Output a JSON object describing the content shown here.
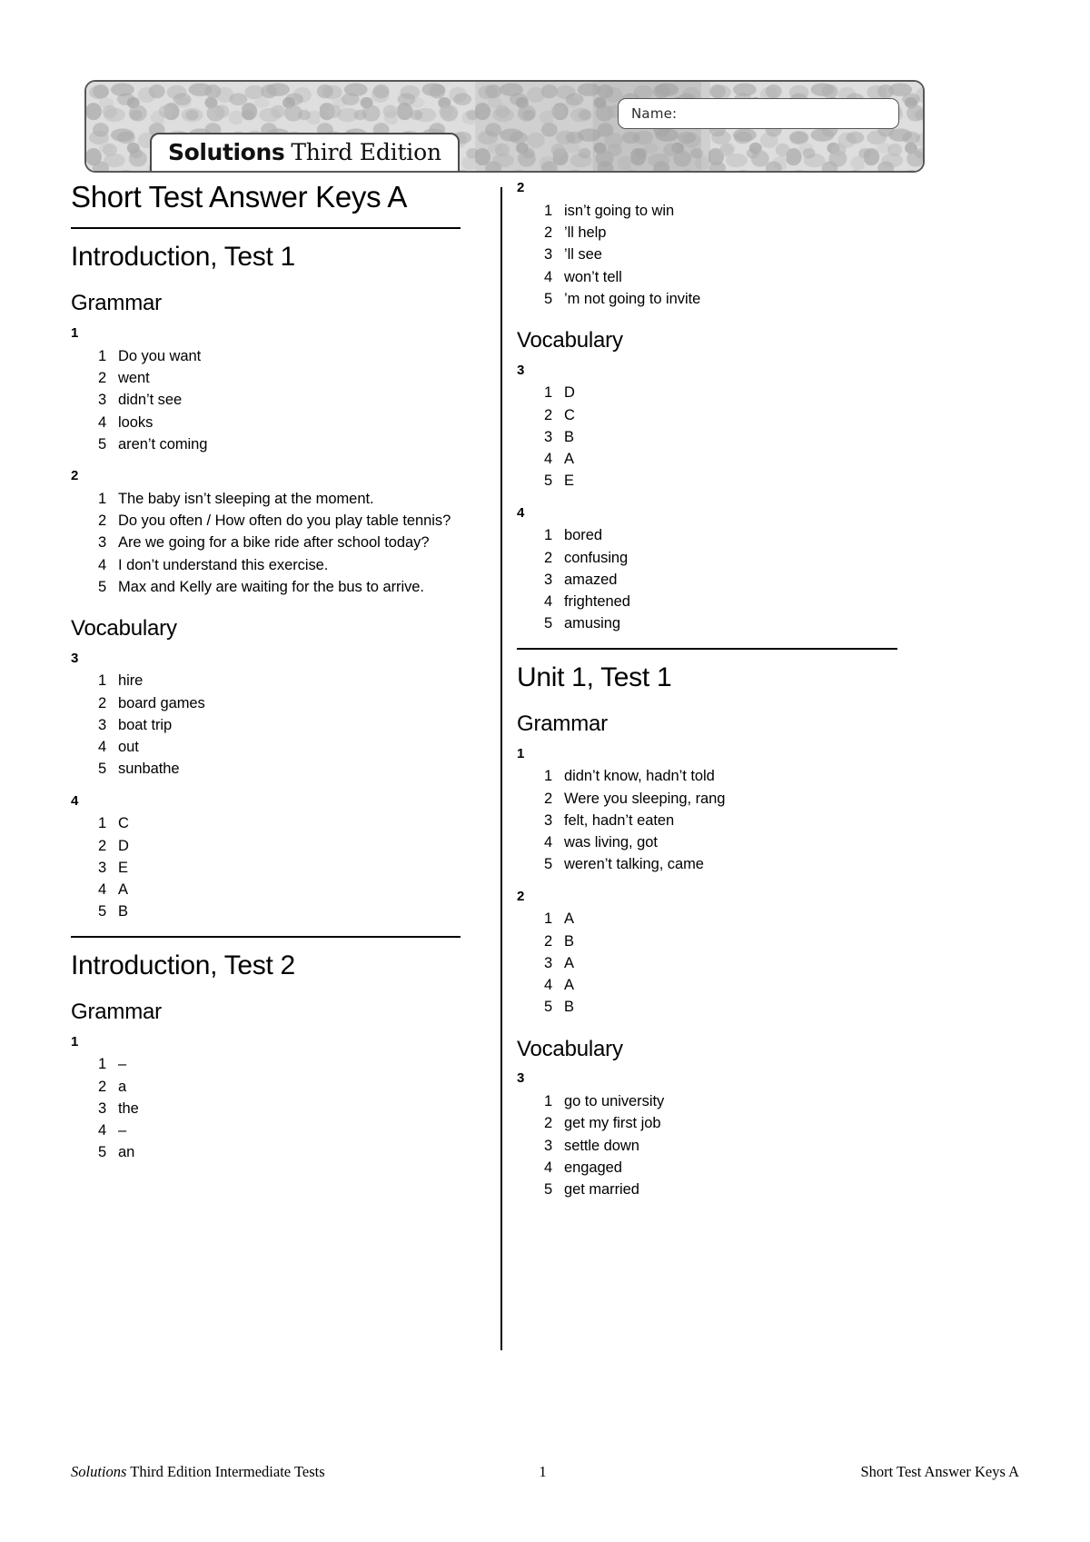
{
  "header": {
    "name_label": "Name:",
    "logo_bold": "Solutions",
    "logo_rest": "Third Edition"
  },
  "document": {
    "title": "Short Test Answer Keys A"
  },
  "sections": {
    "intro_test_1": {
      "title": "Introduction, Test 1",
      "grammar_heading": "Grammar",
      "vocabulary_heading": "Vocabulary",
      "ex1": {
        "num": "1",
        "items": [
          {
            "idx": "1",
            "txt": "Do you want"
          },
          {
            "idx": "2",
            "txt": "went"
          },
          {
            "idx": "3",
            "txt": "didn’t see"
          },
          {
            "idx": "4",
            "txt": "looks"
          },
          {
            "idx": "5",
            "txt": "aren’t coming"
          }
        ]
      },
      "ex2": {
        "num": "2",
        "items": [
          {
            "idx": "1",
            "txt": "The baby isn’t sleeping at the moment."
          },
          {
            "idx": "2",
            "txt": "Do you often / How often do you play table tennis?"
          },
          {
            "idx": "3",
            "txt": "Are we going for a bike ride after school today?"
          },
          {
            "idx": "4",
            "txt": "I don’t understand this exercise."
          },
          {
            "idx": "5",
            "txt": "Max and Kelly are waiting for the bus to arrive."
          }
        ]
      },
      "ex3": {
        "num": "3",
        "items": [
          {
            "idx": "1",
            "txt": "hire"
          },
          {
            "idx": "2",
            "txt": "board games"
          },
          {
            "idx": "3",
            "txt": "boat trip"
          },
          {
            "idx": "4",
            "txt": "out"
          },
          {
            "idx": "5",
            "txt": "sunbathe"
          }
        ]
      },
      "ex4": {
        "num": "4",
        "items": [
          {
            "idx": "1",
            "txt": "C"
          },
          {
            "idx": "2",
            "txt": "D"
          },
          {
            "idx": "3",
            "txt": "E"
          },
          {
            "idx": "4",
            "txt": "A"
          },
          {
            "idx": "5",
            "txt": "B"
          }
        ]
      }
    },
    "intro_test_2": {
      "title": "Introduction, Test 2",
      "grammar_heading": "Grammar",
      "vocabulary_heading": "Vocabulary",
      "ex1": {
        "num": "1",
        "items": [
          {
            "idx": "1",
            "txt": "–"
          },
          {
            "idx": "2",
            "txt": "a"
          },
          {
            "idx": "3",
            "txt": "the"
          },
          {
            "idx": "4",
            "txt": "–"
          },
          {
            "idx": "5",
            "txt": "an"
          }
        ]
      },
      "ex2": {
        "num": "2",
        "items": [
          {
            "idx": "1",
            "txt": "isn’t going to win"
          },
          {
            "idx": "2",
            "txt": "’ll help"
          },
          {
            "idx": "3",
            "txt": "’ll see"
          },
          {
            "idx": "4",
            "txt": "won’t tell"
          },
          {
            "idx": "5",
            "txt": "’m not going to invite"
          }
        ]
      },
      "ex3": {
        "num": "3",
        "items": [
          {
            "idx": "1",
            "txt": "D"
          },
          {
            "idx": "2",
            "txt": "C"
          },
          {
            "idx": "3",
            "txt": "B"
          },
          {
            "idx": "4",
            "txt": "A"
          },
          {
            "idx": "5",
            "txt": "E"
          }
        ]
      },
      "ex4": {
        "num": "4",
        "items": [
          {
            "idx": "1",
            "txt": "bored"
          },
          {
            "idx": "2",
            "txt": "confusing"
          },
          {
            "idx": "3",
            "txt": "amazed"
          },
          {
            "idx": "4",
            "txt": "frightened"
          },
          {
            "idx": "5",
            "txt": "amusing"
          }
        ]
      }
    },
    "unit_1_test_1": {
      "title": "Unit 1, Test 1",
      "grammar_heading": "Grammar",
      "vocabulary_heading": "Vocabulary",
      "ex1": {
        "num": "1",
        "items": [
          {
            "idx": "1",
            "txt": "didn’t know, hadn’t told"
          },
          {
            "idx": "2",
            "txt": "Were you sleeping, rang"
          },
          {
            "idx": "3",
            "txt": "felt, hadn’t eaten"
          },
          {
            "idx": "4",
            "txt": "was living, got"
          },
          {
            "idx": "5",
            "txt": "weren’t talking, came"
          }
        ]
      },
      "ex2": {
        "num": "2",
        "items": [
          {
            "idx": "1",
            "txt": "A"
          },
          {
            "idx": "2",
            "txt": "B"
          },
          {
            "idx": "3",
            "txt": "A"
          },
          {
            "idx": "4",
            "txt": "A"
          },
          {
            "idx": "5",
            "txt": "B"
          }
        ]
      },
      "ex3": {
        "num": "3",
        "items": [
          {
            "idx": "1",
            "txt": "go to university"
          },
          {
            "idx": "2",
            "txt": "get my first job"
          },
          {
            "idx": "3",
            "txt": "settle down"
          },
          {
            "idx": "4",
            "txt": "engaged"
          },
          {
            "idx": "5",
            "txt": "get married"
          }
        ]
      }
    }
  },
  "footer": {
    "left_italic": "Solutions",
    "left_rest": " Third Edition Intermediate Tests",
    "page_number": "1",
    "right": "Short Test Answer Keys A"
  }
}
